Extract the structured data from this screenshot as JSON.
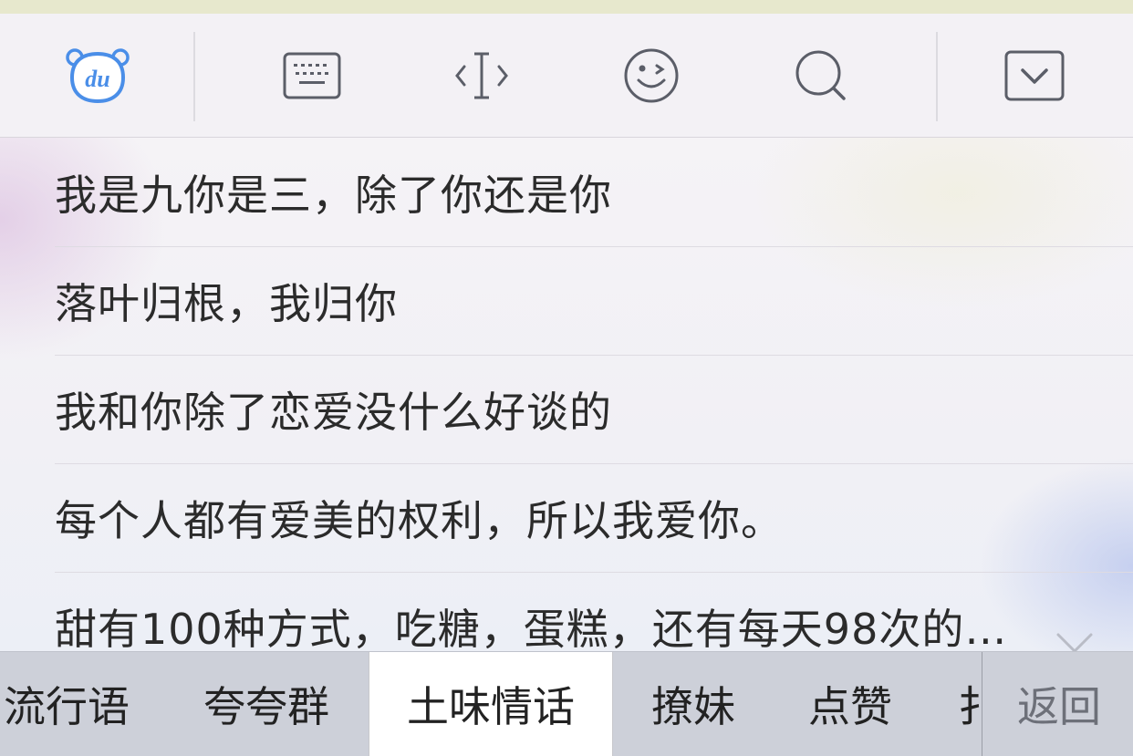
{
  "toolbar": {
    "logo_text": "du",
    "icons": [
      "baidu-logo-icon",
      "keyboard-icon",
      "cursor-move-icon",
      "emoji-icon",
      "search-icon",
      "hide-keyboard-icon"
    ]
  },
  "phrases": [
    "我是九你是三，除了你还是你",
    "落叶归根，我归你",
    "我和你除了恋爱没什么好谈的",
    "每个人都有爱美的权利，所以我爱你。",
    "甜有100种方式，吃糖，蛋糕，还有每天98次的…"
  ],
  "tabs": [
    {
      "label": "流行语",
      "active": false
    },
    {
      "label": "夸夸群",
      "active": false
    },
    {
      "label": "土味情话",
      "active": true
    },
    {
      "label": "撩妹",
      "active": false
    },
    {
      "label": "点赞",
      "active": false
    },
    {
      "label": "扌",
      "active": false
    }
  ],
  "back_label": "返回",
  "colors": {
    "accent_blue": "#4a8ee8",
    "icon_gray": "#5b5e68",
    "active_tab": "#ffffff",
    "tab_bar": "#cdd0d9"
  }
}
